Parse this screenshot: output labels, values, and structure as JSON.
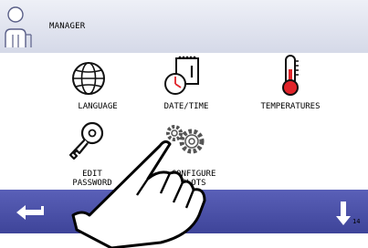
{
  "header": {
    "title": "MANAGER",
    "user_icon": "user-icon"
  },
  "menu": [
    {
      "id": "language",
      "label": "LANGUAGE",
      "icon": "globe-icon"
    },
    {
      "id": "datetime",
      "label": "DATE/TIME",
      "icon": "calendar-clock-icon"
    },
    {
      "id": "temperatures",
      "label": "TEMPERATURES",
      "icon": "thermometer-icon"
    },
    {
      "id": "password",
      "label": "EDIT\nPASSWORD",
      "icon": "key-icon"
    },
    {
      "id": "slots",
      "label": "CONFIGURE\nSLOTS",
      "icon": "gears-icon"
    }
  ],
  "footer": {
    "back_icon": "back-arrow-icon",
    "down_icon": "down-arrow-icon"
  },
  "page_number": "14",
  "colors": {
    "footer": "#454aa3",
    "header": "#dde0ec",
    "thermometer_red": "#e0242a"
  }
}
